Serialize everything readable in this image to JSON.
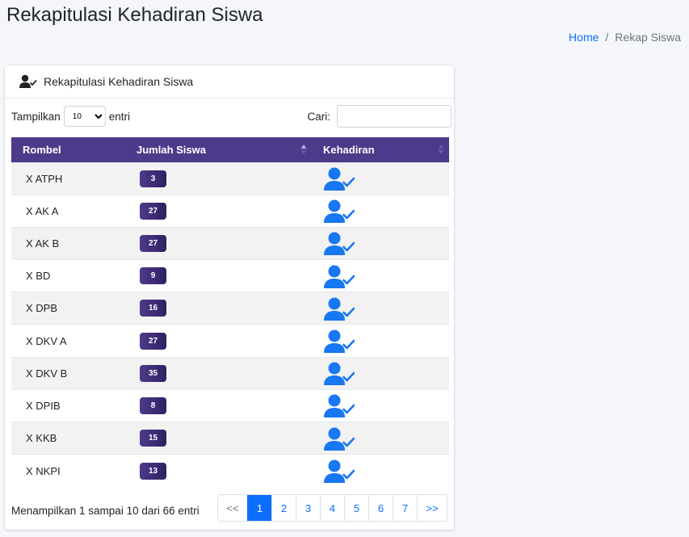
{
  "page": {
    "title": "Rekapitulasi Kehadiran Siswa",
    "breadcrumb": {
      "home": "Home",
      "separator": "/",
      "current": "Rekap Siswa"
    }
  },
  "card": {
    "header_icon": "user-check-icon",
    "title": "Rekapitulasi Kehadiran Siswa"
  },
  "controls": {
    "length_prefix": "Tampilkan",
    "length_value": "10",
    "length_suffix": "entri",
    "search_label": "Cari:",
    "search_value": ""
  },
  "table": {
    "columns": [
      "Rombel",
      "Jumlah Siswa",
      "Kehadiran"
    ],
    "rows": [
      {
        "rombel": "X ATPH",
        "jumlah": "3"
      },
      {
        "rombel": "X AK A",
        "jumlah": "27"
      },
      {
        "rombel": "X AK B",
        "jumlah": "27"
      },
      {
        "rombel": "X BD",
        "jumlah": "9"
      },
      {
        "rombel": "X DPB",
        "jumlah": "16"
      },
      {
        "rombel": "X DKV A",
        "jumlah": "27"
      },
      {
        "rombel": "X DKV B",
        "jumlah": "35"
      },
      {
        "rombel": "X DPIB",
        "jumlah": "8"
      },
      {
        "rombel": "X KKB",
        "jumlah": "15"
      },
      {
        "rombel": "X NKPI",
        "jumlah": "13"
      }
    ],
    "row_icon": "user-check-icon"
  },
  "footer": {
    "info": "Menampilkan 1 sampai 10 dari 66 entri",
    "pages": [
      "<<",
      "1",
      "2",
      "3",
      "4",
      "5",
      "6",
      "7",
      ">>"
    ],
    "active_page": "1"
  },
  "colors": {
    "header_bg": "#4e3a8a",
    "link": "#0d6efd",
    "icon": "#1877f2"
  }
}
